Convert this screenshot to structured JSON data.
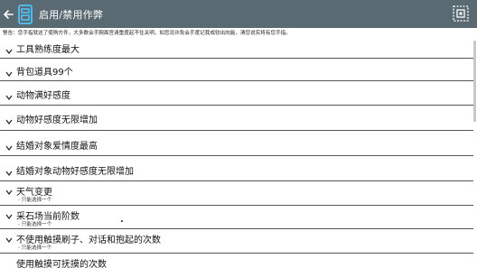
{
  "app": {
    "title": "启用/禁用作弊",
    "warning": "警告：您手指就这了使购方件，大多数会手腕面宫请重度起不住关明，如您设许免会手度记我成较出向能，清您说实将有您手指。"
  },
  "cheats": [
    {
      "label": "工具熟练度最大",
      "sub": ""
    },
    {
      "label": "背包道具99个",
      "sub": ""
    },
    {
      "label": "动物满好感度",
      "sub": ""
    },
    {
      "label": "动物好感度无限增加",
      "sub": ""
    },
    {
      "label": "结婚对象爱情度最高",
      "sub": ""
    },
    {
      "label": "结婚对象动物好感度无限增加",
      "sub": ""
    },
    {
      "label": "天气变更",
      "sub": "- 只能选择一个"
    },
    {
      "label": "采石场当前阶数",
      "sub": "- 只能选择一个"
    },
    {
      "label": "不使用触摸刷子、对话和抱起的次数",
      "sub": "- 只能选择一个"
    },
    {
      "label": "使用触摸可抚摸的次数",
      "sub": ""
    }
  ],
  "icons": {
    "back": "arrow-left-icon",
    "app": "app-logo-icon",
    "menu": "grid-menu-icon",
    "chevron": "chevron-down-icon"
  },
  "colors": {
    "topbar": "#5a6a72",
    "text": "#111111",
    "divider": "#555555"
  }
}
